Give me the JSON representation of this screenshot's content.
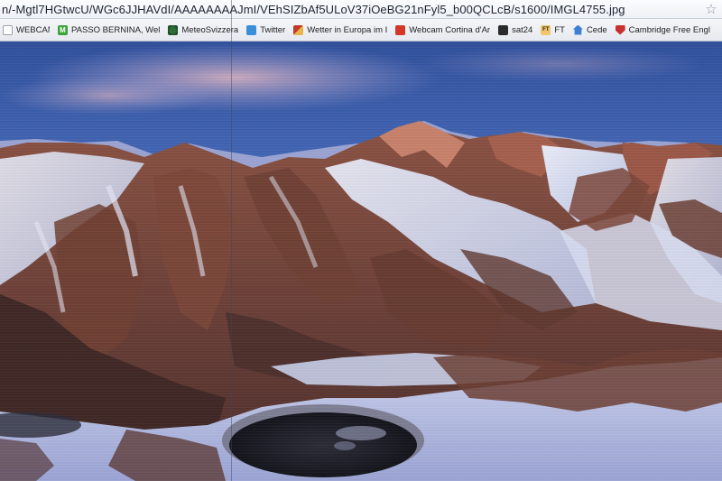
{
  "browser": {
    "url": "n/-Mgtl7HGtwcU/WGc6JJHAVdI/AAAAAAAAJmI/VEhSIZbAf5ULoV37iOeBG21nFyl5_b00QCLcB/s1600/IMGL4755.jpg",
    "star_icon": "☆"
  },
  "bookmarks": [
    {
      "label": "WEBCAM M...",
      "icon": "doc-icon"
    },
    {
      "label": "PASSO BERNINA, Wel",
      "icon": "green-m-icon",
      "glyph": "M"
    },
    {
      "label": "MeteoSvizzera",
      "icon": "meteo-icon"
    },
    {
      "label": "Twitter",
      "icon": "twitter-icon"
    },
    {
      "label": "Wetter in Europa im I",
      "icon": "wetter-icon"
    },
    {
      "label": "Webcam Cortina d'Ar",
      "icon": "cloud-icon"
    },
    {
      "label": "sat24",
      "icon": "sat-icon"
    },
    {
      "label": "FT",
      "icon": "ft-icon",
      "glyph": "FT"
    },
    {
      "label": "Cede",
      "icon": "home-icon"
    },
    {
      "label": "Cambridge Free Engl",
      "icon": "shield-icon"
    }
  ]
}
